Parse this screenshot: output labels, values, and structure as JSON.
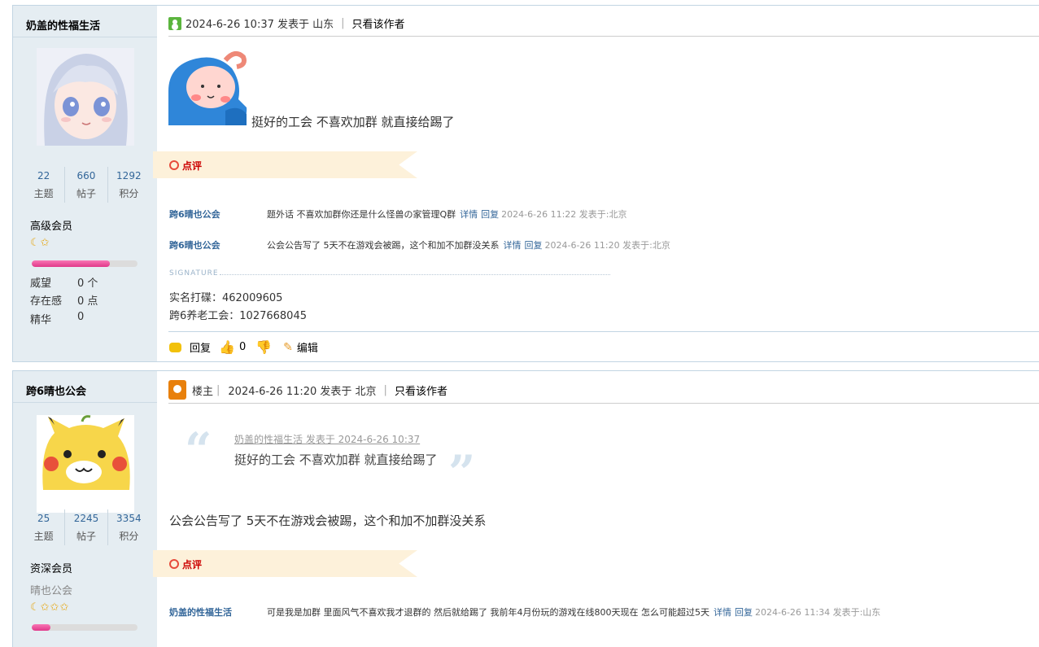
{
  "posts": [
    {
      "author": "奶盖的性福生活",
      "stats": [
        {
          "value": "22",
          "label": "主题"
        },
        {
          "value": "660",
          "label": "帖子"
        },
        {
          "value": "1292",
          "label": "积分"
        }
      ],
      "rank": "高级会员",
      "stars": "☾✩",
      "progress": 0.74,
      "props": [
        {
          "label": "威望",
          "value": "0 个"
        },
        {
          "label": "存在感",
          "value": "0 点"
        },
        {
          "label": "精华",
          "value": "0"
        }
      ],
      "header": {
        "time": "2024-6-26 10:37 发表于 山东",
        "only_author": "只看该作者"
      },
      "content": "挺好的工会 不喜欢加群 就直接给踢了",
      "ribbon": "点评",
      "comments": [
        {
          "user": "跨6晴也公会",
          "text": "题外话 不喜欢加群你还是什么怪兽の家管理Q群",
          "detail": "详情",
          "reply": "回复",
          "date": "2024-6-26 11:22 发表于:北京"
        },
        {
          "user": "跨6晴也公会",
          "text": "公会公告写了 5天不在游戏会被踢，这个和加不加群没关系",
          "detail": "详情",
          "reply": "回复",
          "date": "2024-6-26 11:20 发表于:北京"
        }
      ],
      "signature_label": "SIGNATURE",
      "signature": [
        "实名打碟：462009605",
        "跨6养老工会：1027668045"
      ],
      "actions": {
        "reply": "回复",
        "likes": "0",
        "edit": "编辑"
      }
    },
    {
      "author": "跨6晴也公会",
      "stats": [
        {
          "value": "25",
          "label": "主题"
        },
        {
          "value": "2245",
          "label": "帖子"
        },
        {
          "value": "3354",
          "label": "积分"
        }
      ],
      "rank": "资深会员",
      "guild": "晴也公会",
      "stars": "☾✩✩✩",
      "progress": 0.18,
      "header": {
        "host": "楼主",
        "time": "2024-6-26 11:20 发表于 北京",
        "only_author": "只看该作者"
      },
      "quote": {
        "meta": "奶盖的性福生活 发表于 2024-6-26 10:37",
        "text": "挺好的工会 不喜欢加群 就直接给踢了"
      },
      "content": "公会公告写了 5天不在游戏会被踢，这个和加不加群没关系",
      "ribbon": "点评",
      "comments": [
        {
          "user": "奶盖的性福生活",
          "text": "可是我是加群 里面风气不喜欢我才退群的 然后就给踢了 我前年4月份玩的游戏在线800天现在 怎么可能超过5天",
          "detail": "详情",
          "reply": "回复",
          "date": "2024-6-26 11:34 发表于:山东"
        }
      ]
    }
  ]
}
